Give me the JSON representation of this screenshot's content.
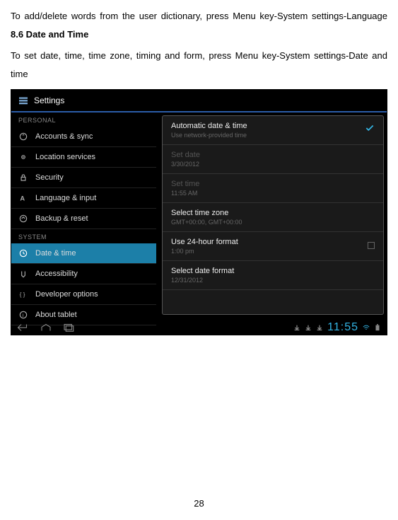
{
  "doc": {
    "text1_a": "To  add/delete  words  from  the  user  dictionary,  press  Menu  key-System settings-Language ",
    "section_title": "8.6 Date and Time",
    "text2": "To  set  date,  time,  time  zone,  timing  and  form,  press  Menu  key-System settings-Date and time",
    "page_number": "28"
  },
  "titlebar": {
    "title": "Settings"
  },
  "sidebar": {
    "header_personal": "PERSONAL",
    "header_system": "SYSTEM",
    "items_personal": [
      {
        "label": "Accounts & sync",
        "icon": "sync"
      },
      {
        "label": "Location services",
        "icon": "location"
      },
      {
        "label": "Security",
        "icon": "lock"
      },
      {
        "label": "Language & input",
        "icon": "language"
      },
      {
        "label": "Backup & reset",
        "icon": "backup"
      }
    ],
    "items_system": [
      {
        "label": "Date & time",
        "icon": "clock",
        "active": true
      },
      {
        "label": "Accessibility",
        "icon": "hand"
      },
      {
        "label": "Developer options",
        "icon": "braces"
      },
      {
        "label": "About tablet",
        "icon": "info"
      }
    ]
  },
  "panel": {
    "items": [
      {
        "title": "Automatic date & time",
        "sub": "Use network-provided time",
        "checked": true
      },
      {
        "title": "Set date",
        "sub": "3/30/2012",
        "disabled": true
      },
      {
        "title": "Set time",
        "sub": "11:55 AM",
        "disabled": true
      },
      {
        "title": "Select time zone",
        "sub": "GMT+00:00, GMT+00:00"
      },
      {
        "title": "Use 24-hour format",
        "sub": "1:00 pm",
        "checkbox": true
      },
      {
        "title": "Select date format",
        "sub": "12/31/2012"
      }
    ]
  },
  "navbar": {
    "time": "11:55"
  }
}
